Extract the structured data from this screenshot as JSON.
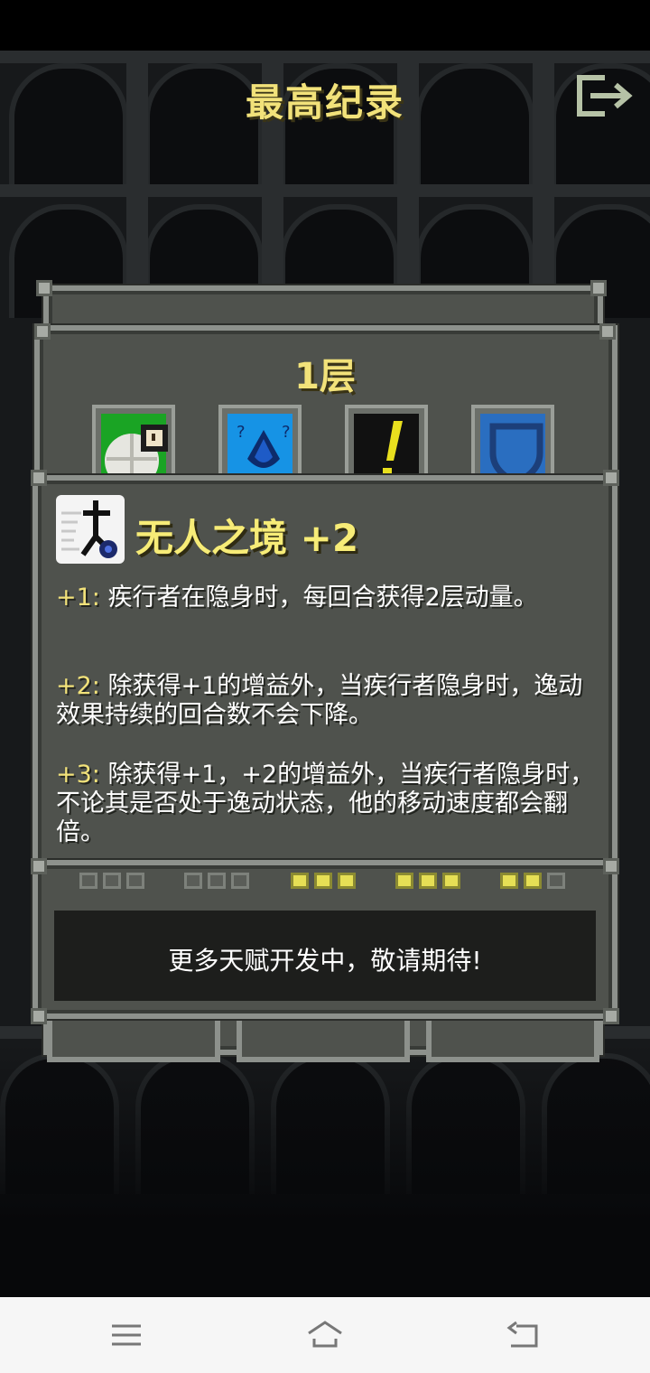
{
  "header": {
    "title": "最高纪录",
    "exit_icon": "exit-icon"
  },
  "floor": {
    "label": "1层",
    "talents": [
      {
        "icon": "scroll-map-icon",
        "color": "#1aa424"
      },
      {
        "icon": "dripping-bag-icon",
        "color": "#1693e5"
      },
      {
        "icon": "exclamation-icon",
        "color": "#e8df1e"
      },
      {
        "icon": "shield-icon",
        "color": "#2a6ec0"
      }
    ]
  },
  "talent_detail": {
    "icon": "runner-icon",
    "name": "无人之境 +2",
    "levels": [
      {
        "tag": "+1:",
        "text": " 疾行者在隐身时，每回合获得2层动量。"
      },
      {
        "tag": "+2:",
        "text": " 除获得+1的增益外，当疾行者隐身时，逸动效果持续的回合数不会下降。"
      },
      {
        "tag": "+3:",
        "text": " 除获得+1，+2的增益外，当疾行者隐身时，不论其是否处于逸动状态，他的移动速度都会翻倍。"
      }
    ]
  },
  "talent_points": [
    {
      "filled": 0,
      "total": 3
    },
    {
      "filled": 0,
      "total": 3
    },
    {
      "filled": 3,
      "total": 3
    },
    {
      "filled": 3,
      "total": 3
    },
    {
      "filled": 2,
      "total": 3
    }
  ],
  "notice": "更多天赋开发中，敬请期待!",
  "navbar": {
    "menu_icon": "menu-icon",
    "home_icon": "home-icon",
    "back_icon": "back-icon"
  }
}
